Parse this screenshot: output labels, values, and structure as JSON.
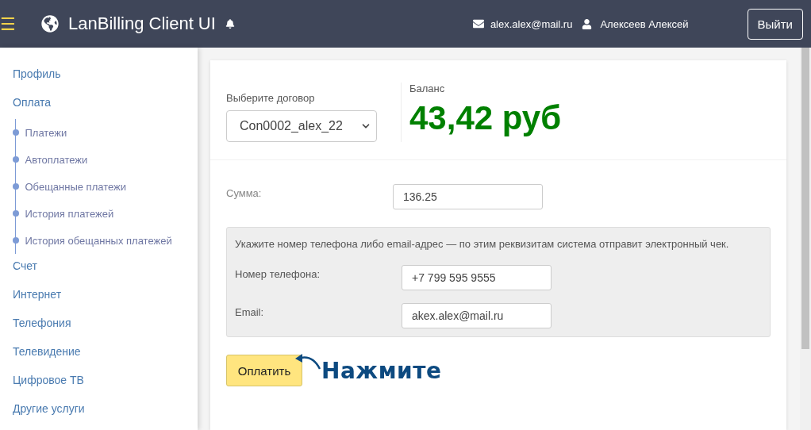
{
  "header": {
    "menu_icon": "☰",
    "title": "LanBilling Client UI",
    "email": "alex.alex@mail.ru",
    "user": "Алексеев Алексей",
    "logout": "Выйти"
  },
  "sidebar": {
    "items": [
      {
        "label": "Профиль"
      },
      {
        "label": "Оплата",
        "children": [
          {
            "label": "Платежи"
          },
          {
            "label": "Автоплатежи"
          },
          {
            "label": "Обещанные платежи"
          },
          {
            "label": "История платежей"
          },
          {
            "label": "История обещанных платежей"
          }
        ]
      },
      {
        "label": "Счет"
      },
      {
        "label": "Интернет"
      },
      {
        "label": "Телефония"
      },
      {
        "label": "Телевидение"
      },
      {
        "label": "Цифровое ТВ"
      },
      {
        "label": "Другие услуги"
      }
    ]
  },
  "contract": {
    "label": "Выберите договор",
    "value": "Con0002_alex_22"
  },
  "balance": {
    "label": "Баланс",
    "value": "43,42 руб"
  },
  "amount": {
    "label": "Сумма:",
    "value": "136.25"
  },
  "receipt": {
    "note": "Укажите номер телефона либо email-адрес — по этим реквизитам система отправит электронный чек.",
    "fields": [
      {
        "label": "Номер телефона:",
        "value": "+7 799 595 9555"
      },
      {
        "label": "Email:",
        "value": "akex.alex@mail.ru"
      }
    ]
  },
  "pay_button": "Оплатить",
  "annotation": "Нажмите"
}
